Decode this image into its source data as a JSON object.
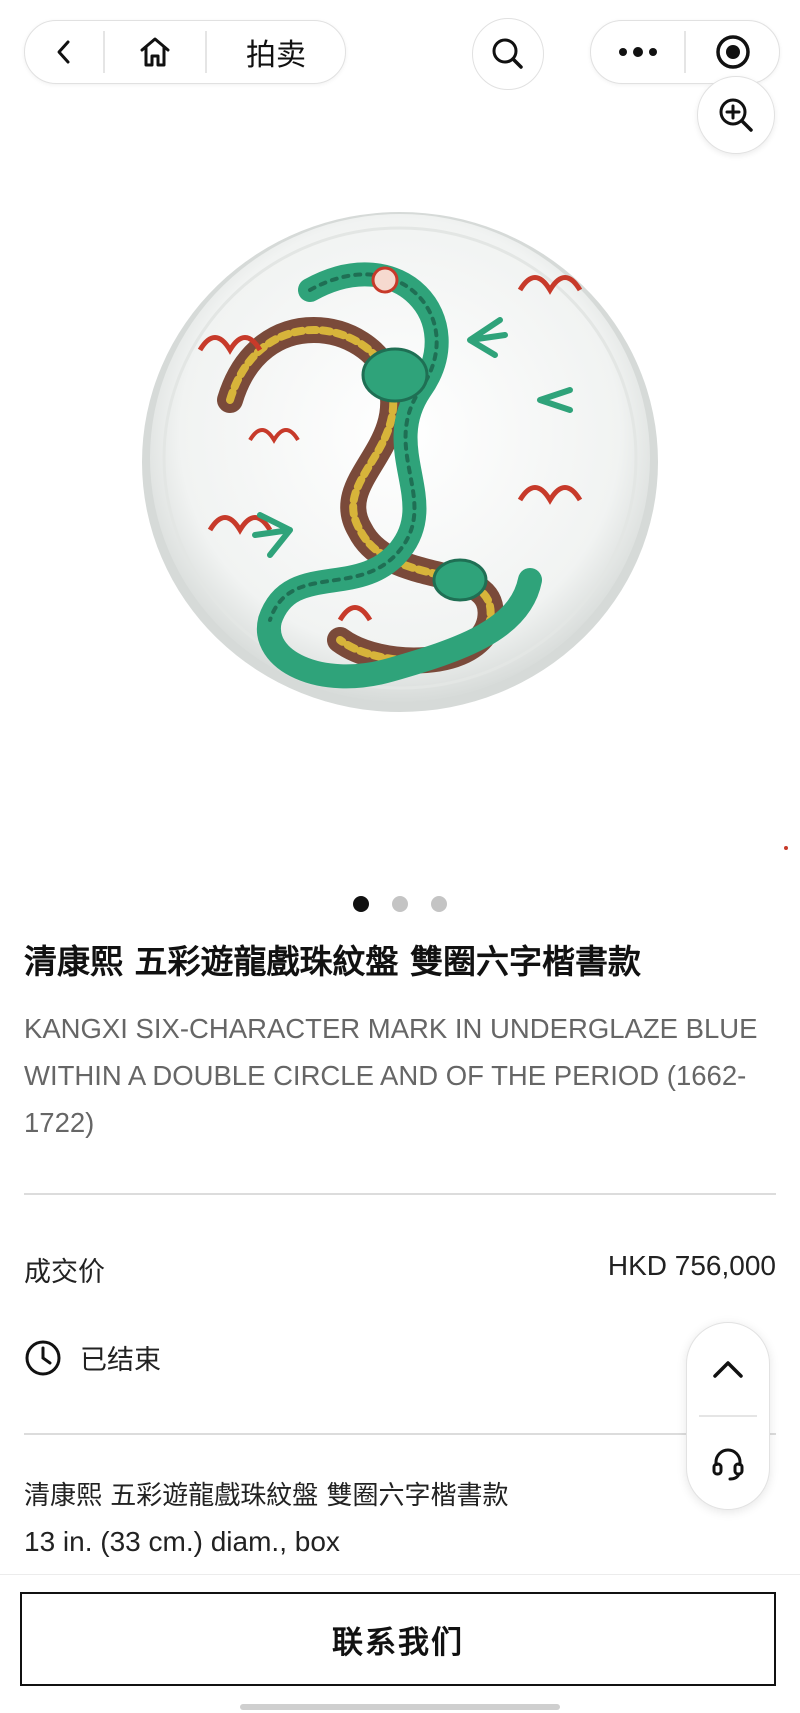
{
  "nav": {
    "title": "拍卖"
  },
  "carousel": {
    "dot_count": 3,
    "active_index": 0
  },
  "lot": {
    "title_zh": "清康熙 五彩遊龍戲珠紋盤 雙圈六字楷書款",
    "subtitle_en": "KANGXI SIX-CHARACTER MARK IN UNDERGLAZE BLUE WITHIN A DOUBLE CIRCLE AND OF THE PERIOD (1662-1722)"
  },
  "price": {
    "label": "成交价",
    "value": "HKD 756,000"
  },
  "status": {
    "label": "已结束"
  },
  "details": {
    "line1": "清康熙 五彩遊龍戲珠紋盤 雙圈六字楷書款",
    "line2": "13 in. (33 cm.) diam., box"
  },
  "footer": {
    "contact_label": "联系我们"
  },
  "colors": {
    "accent": "#111111",
    "dragon_green": "#2fa37a",
    "dragon_red": "#c73a2a",
    "dragon_brown": "#7a4a3a",
    "dragon_yellow": "#d7b43a"
  },
  "icons": [
    "back-icon",
    "home-icon",
    "search-icon",
    "more-icon",
    "record-icon",
    "zoom-in-icon",
    "clock-icon",
    "chevron-up-icon",
    "headset-icon"
  ]
}
